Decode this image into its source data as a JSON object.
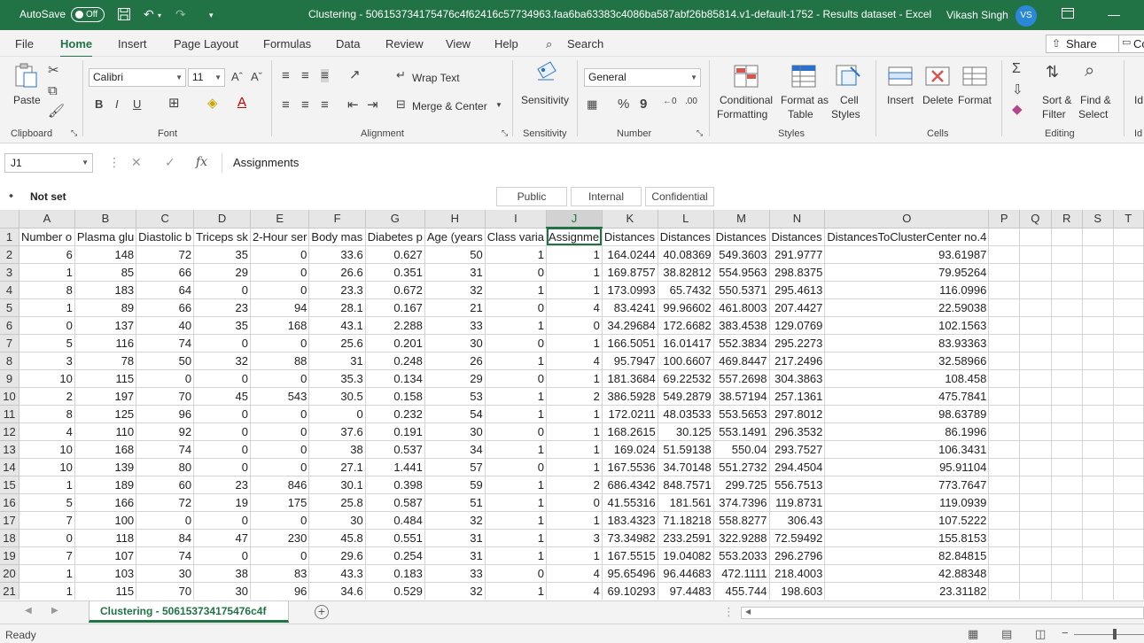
{
  "titlebar": {
    "autosave_label": "AutoSave",
    "autosave_state": "Off",
    "title": "Clustering - 506153734175476c4f62416c57734963.faa6ba63383c4086ba587abf26b85814.v1-default-1752 - Results dataset  -  Excel",
    "user": "Vikash Singh",
    "avatar": "VS"
  },
  "menu": {
    "tabs": [
      "File",
      "Home",
      "Insert",
      "Page Layout",
      "Formulas",
      "Data",
      "Review",
      "View",
      "Help"
    ],
    "search": "Search",
    "share": "Share",
    "comments": "Co"
  },
  "ribbon": {
    "paste": "Paste",
    "clipboard": "Clipboard",
    "font_name": "Calibri",
    "font_size": "11",
    "font": "Font",
    "wrap_text": "Wrap Text",
    "merge_center": "Merge & Center",
    "alignment": "Alignment",
    "sensitivity": "Sensitivity",
    "sensitivity_group": "Sensitivity",
    "number_format": "General",
    "number": "Number",
    "conditional_1": "Conditional",
    "conditional_2": "Formatting",
    "format_as_1": "Format as",
    "format_as_2": "Table",
    "cell_styles_1": "Cell",
    "cell_styles_2": "Styles",
    "styles": "Styles",
    "insert": "Insert",
    "delete": "Delete",
    "format": "Format",
    "cells": "Cells",
    "sort_1": "Sort &",
    "sort_2": "Filter",
    "find_1": "Find &",
    "find_2": "Select",
    "editing": "Editing",
    "ideas": "Id"
  },
  "formula": {
    "namebox": "J1",
    "value": "Assignments"
  },
  "sensitivity_bar": {
    "label": "Not set",
    "public": "Public",
    "internal": "Internal",
    "confidential": "Confidential"
  },
  "columns": [
    "A",
    "B",
    "C",
    "D",
    "E",
    "F",
    "G",
    "H",
    "I",
    "J",
    "K",
    "L",
    "M",
    "N",
    "O",
    "P",
    "Q",
    "R",
    "S",
    "T"
  ],
  "header_row": [
    "Number o",
    "Plasma glu",
    "Diastolic b",
    "Triceps sk",
    "2-Hour ser",
    "Body mas",
    "Diabetes p",
    "Age (years",
    "Class varia",
    "Assignme",
    "Distances",
    "Distances",
    "Distances",
    "Distances",
    "DistancesToClusterCenter no.4"
  ],
  "rows": [
    [
      "6",
      "148",
      "72",
      "35",
      "0",
      "33.6",
      "0.627",
      "50",
      "1",
      "1",
      "164.0244",
      "40.08369",
      "549.3603",
      "291.9777",
      "93.61987"
    ],
    [
      "1",
      "85",
      "66",
      "29",
      "0",
      "26.6",
      "0.351",
      "31",
      "0",
      "1",
      "169.8757",
      "38.82812",
      "554.9563",
      "298.8375",
      "79.95264"
    ],
    [
      "8",
      "183",
      "64",
      "0",
      "0",
      "23.3",
      "0.672",
      "32",
      "1",
      "1",
      "173.0993",
      "65.7432",
      "550.5371",
      "295.4613",
      "116.0996"
    ],
    [
      "1",
      "89",
      "66",
      "23",
      "94",
      "28.1",
      "0.167",
      "21",
      "0",
      "4",
      "83.4241",
      "99.96602",
      "461.8003",
      "207.4427",
      "22.59038"
    ],
    [
      "0",
      "137",
      "40",
      "35",
      "168",
      "43.1",
      "2.288",
      "33",
      "1",
      "0",
      "34.29684",
      "172.6682",
      "383.4538",
      "129.0769",
      "102.1563"
    ],
    [
      "5",
      "116",
      "74",
      "0",
      "0",
      "25.6",
      "0.201",
      "30",
      "0",
      "1",
      "166.5051",
      "16.01417",
      "552.3834",
      "295.2273",
      "83.93363"
    ],
    [
      "3",
      "78",
      "50",
      "32",
      "88",
      "31",
      "0.248",
      "26",
      "1",
      "4",
      "95.7947",
      "100.6607",
      "469.8447",
      "217.2496",
      "32.58966"
    ],
    [
      "10",
      "115",
      "0",
      "0",
      "0",
      "35.3",
      "0.134",
      "29",
      "0",
      "1",
      "181.3684",
      "69.22532",
      "557.2698",
      "304.3863",
      "108.458"
    ],
    [
      "2",
      "197",
      "70",
      "45",
      "543",
      "30.5",
      "0.158",
      "53",
      "1",
      "2",
      "386.5928",
      "549.2879",
      "38.57194",
      "257.1361",
      "475.7841"
    ],
    [
      "8",
      "125",
      "96",
      "0",
      "0",
      "0",
      "0.232",
      "54",
      "1",
      "1",
      "172.0211",
      "48.03533",
      "553.5653",
      "297.8012",
      "98.63789"
    ],
    [
      "4",
      "110",
      "92",
      "0",
      "0",
      "37.6",
      "0.191",
      "30",
      "0",
      "1",
      "168.2615",
      "30.125",
      "553.1491",
      "296.3532",
      "86.1996"
    ],
    [
      "10",
      "168",
      "74",
      "0",
      "0",
      "38",
      "0.537",
      "34",
      "1",
      "1",
      "169.024",
      "51.59138",
      "550.04",
      "293.7527",
      "106.3431"
    ],
    [
      "10",
      "139",
      "80",
      "0",
      "0",
      "27.1",
      "1.441",
      "57",
      "0",
      "1",
      "167.5536",
      "34.70148",
      "551.2732",
      "294.4504",
      "95.91104"
    ],
    [
      "1",
      "189",
      "60",
      "23",
      "846",
      "30.1",
      "0.398",
      "59",
      "1",
      "2",
      "686.4342",
      "848.7571",
      "299.725",
      "556.7513",
      "773.7647"
    ],
    [
      "5",
      "166",
      "72",
      "19",
      "175",
      "25.8",
      "0.587",
      "51",
      "1",
      "0",
      "41.55316",
      "181.561",
      "374.7396",
      "119.8731",
      "119.0939"
    ],
    [
      "7",
      "100",
      "0",
      "0",
      "0",
      "30",
      "0.484",
      "32",
      "1",
      "1",
      "183.4323",
      "71.18218",
      "558.8277",
      "306.43",
      "107.5222"
    ],
    [
      "0",
      "118",
      "84",
      "47",
      "230",
      "45.8",
      "0.551",
      "31",
      "1",
      "3",
      "73.34982",
      "233.2591",
      "322.9288",
      "72.59492",
      "155.8153"
    ],
    [
      "7",
      "107",
      "74",
      "0",
      "0",
      "29.6",
      "0.254",
      "31",
      "1",
      "1",
      "167.5515",
      "19.04082",
      "553.2033",
      "296.2796",
      "82.84815"
    ],
    [
      "1",
      "103",
      "30",
      "38",
      "83",
      "43.3",
      "0.183",
      "33",
      "0",
      "4",
      "95.65496",
      "96.44683",
      "472.1111",
      "218.4003",
      "42.88348"
    ],
    [
      "1",
      "115",
      "70",
      "30",
      "96",
      "34.6",
      "0.529",
      "32",
      "1",
      "4",
      "69.10293",
      "97.4483",
      "455.744",
      "198.603",
      "23.31182"
    ]
  ],
  "sheet_tab": "Clustering - 506153734175476c4f",
  "status": "Ready"
}
